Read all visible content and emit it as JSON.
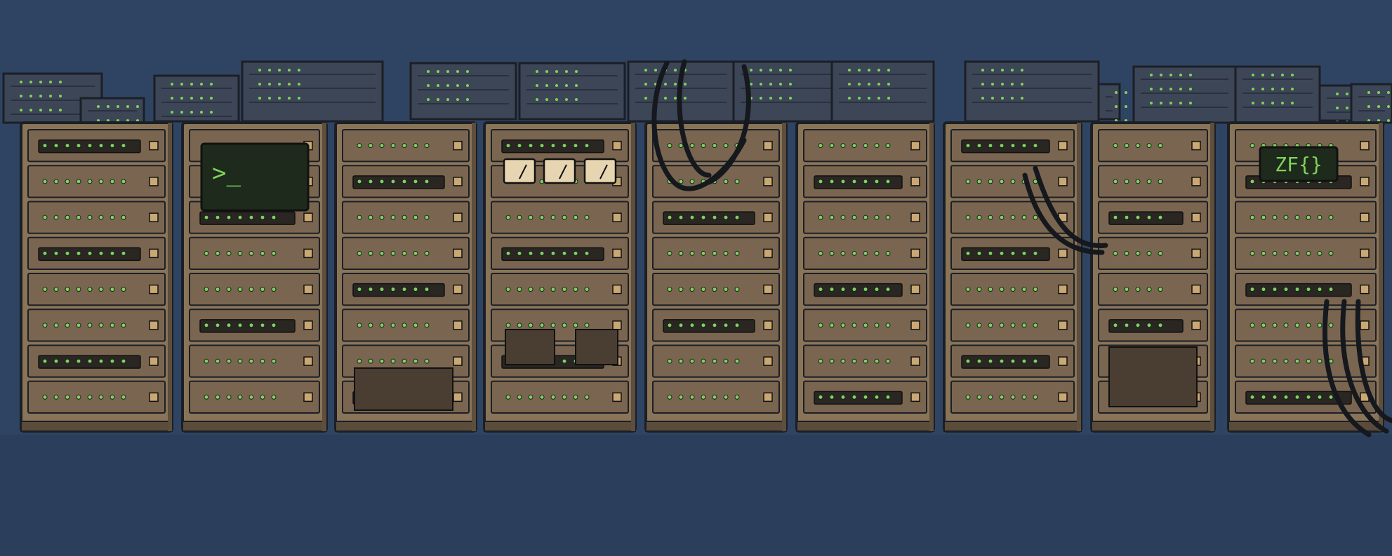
{
  "scene": {
    "terminal_prompt": ">_",
    "display_text": "ZF{}"
  },
  "palette": {
    "background": "#2f4462",
    "background_dark": "#22324a",
    "rack_fill": "#8a7458",
    "rack_panel": "#7a6650",
    "rack_outline": "#1b1f26",
    "indicator_green": "#7fd35a",
    "screen": "#1e2a1c",
    "cable": "#15181d"
  }
}
